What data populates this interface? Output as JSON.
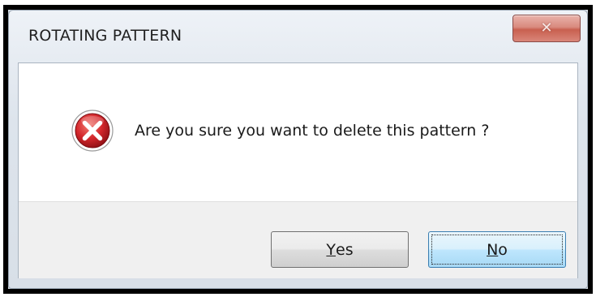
{
  "window": {
    "title": "ROTATING PATTERN",
    "close_icon": "close-icon"
  },
  "dialog": {
    "icon": "error-icon",
    "message": "Are you sure you want to delete this pattern ?"
  },
  "buttons": {
    "yes_accel": "Y",
    "yes_rest": "es",
    "no_accel": "N",
    "no_rest": "o",
    "default": "No"
  },
  "colors": {
    "error_red": "#c8262b",
    "close_button_red": "#c8604f",
    "default_button_border": "#3c7fb1"
  }
}
